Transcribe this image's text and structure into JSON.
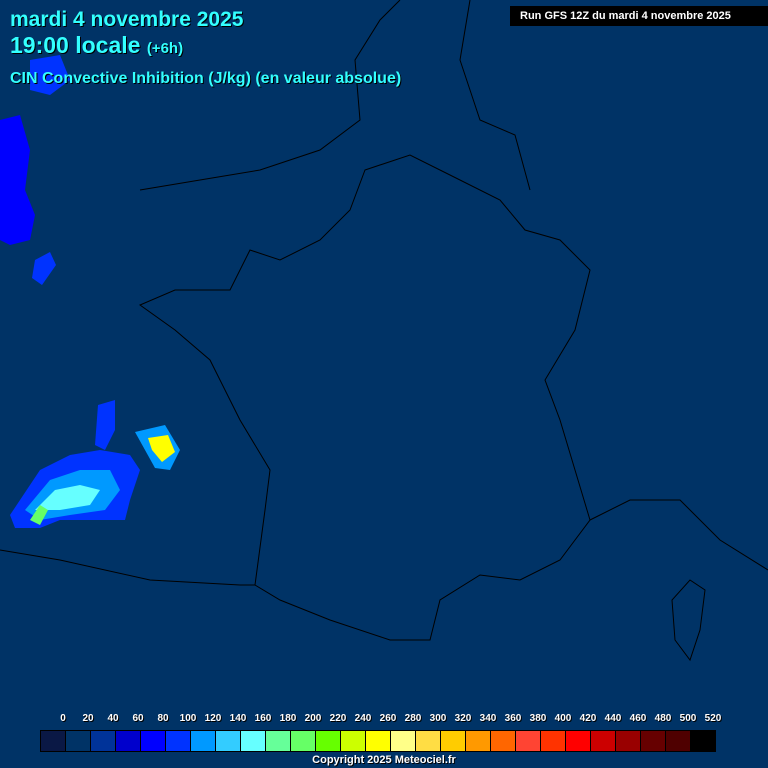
{
  "header": {
    "date": "mardi 4 novembre 2025",
    "time": "19:00 locale",
    "offset": "(+6h)",
    "parameter": "CIN Convective Inhibition (J/kg) (en valeur absolue)",
    "run": "Run GFS 12Z du mardi 4 novembre 2025"
  },
  "legend": {
    "labels": [
      "0",
      "20",
      "40",
      "60",
      "80",
      "100",
      "120",
      "140",
      "160",
      "180",
      "200",
      "220",
      "240",
      "260",
      "280",
      "300",
      "320",
      "340",
      "360",
      "380",
      "400",
      "420",
      "440",
      "460",
      "480",
      "500",
      "520"
    ],
    "colors": [
      "#0a1845",
      "#003366",
      "#003399",
      "#0000cc",
      "#0000ff",
      "#0033ff",
      "#0099ff",
      "#33ccff",
      "#66ffff",
      "#66ff99",
      "#66ff66",
      "#66ff00",
      "#ccff00",
      "#ffff00",
      "#ffff88",
      "#ffdd44",
      "#ffcc00",
      "#ff9900",
      "#ff6600",
      "#ff4433",
      "#ff3300",
      "#ff0000",
      "#cc0000",
      "#990000",
      "#660000",
      "#4f0000",
      "#000000"
    ]
  },
  "footer": {
    "copyright": "Copyright 2025 Meteociel.fr"
  }
}
